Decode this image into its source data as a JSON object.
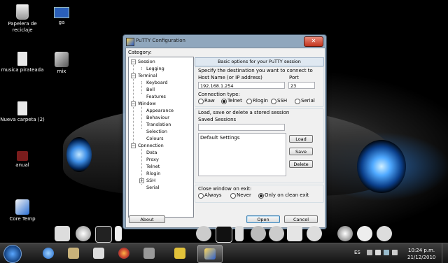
{
  "desktop": {
    "icons": [
      {
        "label": "Papelera de reciclaje",
        "icon": "recycle-bin-icon"
      },
      {
        "label": "ga",
        "icon": "image-icon"
      },
      {
        "label": "musica pirateada",
        "icon": "folder-icon"
      },
      {
        "label": "mix",
        "icon": "media-icon"
      },
      {
        "label": "Nueva carpeta (2)",
        "icon": "folder-icon"
      },
      {
        "label": "anual",
        "icon": "file-icon"
      },
      {
        "label": "Core Temp",
        "icon": "thermometer-icon"
      }
    ]
  },
  "putty": {
    "title": "PuTTY Configuration",
    "category_label": "Category:",
    "tree": {
      "session": "Session",
      "logging": "Logging",
      "terminal": "Terminal",
      "keyboard": "Keyboard",
      "bell": "Bell",
      "features": "Features",
      "window": "Window",
      "appearance": "Appearance",
      "behaviour": "Behaviour",
      "translation": "Translation",
      "selection": "Selection",
      "colours": "Colours",
      "connection": "Connection",
      "data": "Data",
      "proxy": "Proxy",
      "telnet": "Telnet",
      "rlogin": "Rlogin",
      "ssh": "SSH",
      "serial": "Serial"
    },
    "header": "Basic options for your PuTTY session",
    "destination_label": "Specify the destination you want to connect to",
    "host_label": "Host Name (or IP address)",
    "port_label": "Port",
    "host_value": "192.168.1.254",
    "port_value": "23",
    "conn_type_label": "Connection type:",
    "conn_types": [
      "Raw",
      "Telnet",
      "Rlogin",
      "SSH",
      "Serial"
    ],
    "conn_selected": "Telnet",
    "sessions_group": "Load, save or delete a stored session",
    "saved_sessions_label": "Saved Sessions",
    "saved_sessions_input": "",
    "sessions_list": [
      "Default Settings"
    ],
    "load": "Load",
    "save": "Save",
    "delete": "Delete",
    "close_label": "Close window on exit:",
    "close_options": [
      "Always",
      "Never",
      "Only on clean exit"
    ],
    "close_selected": "Only on clean exit",
    "about": "About",
    "open": "Open",
    "cancel": "Cancel",
    "close_glyph": "✕"
  },
  "taskbar": {
    "language": "ES",
    "time": "10:24 p.m.",
    "date": "21/12/2010"
  }
}
